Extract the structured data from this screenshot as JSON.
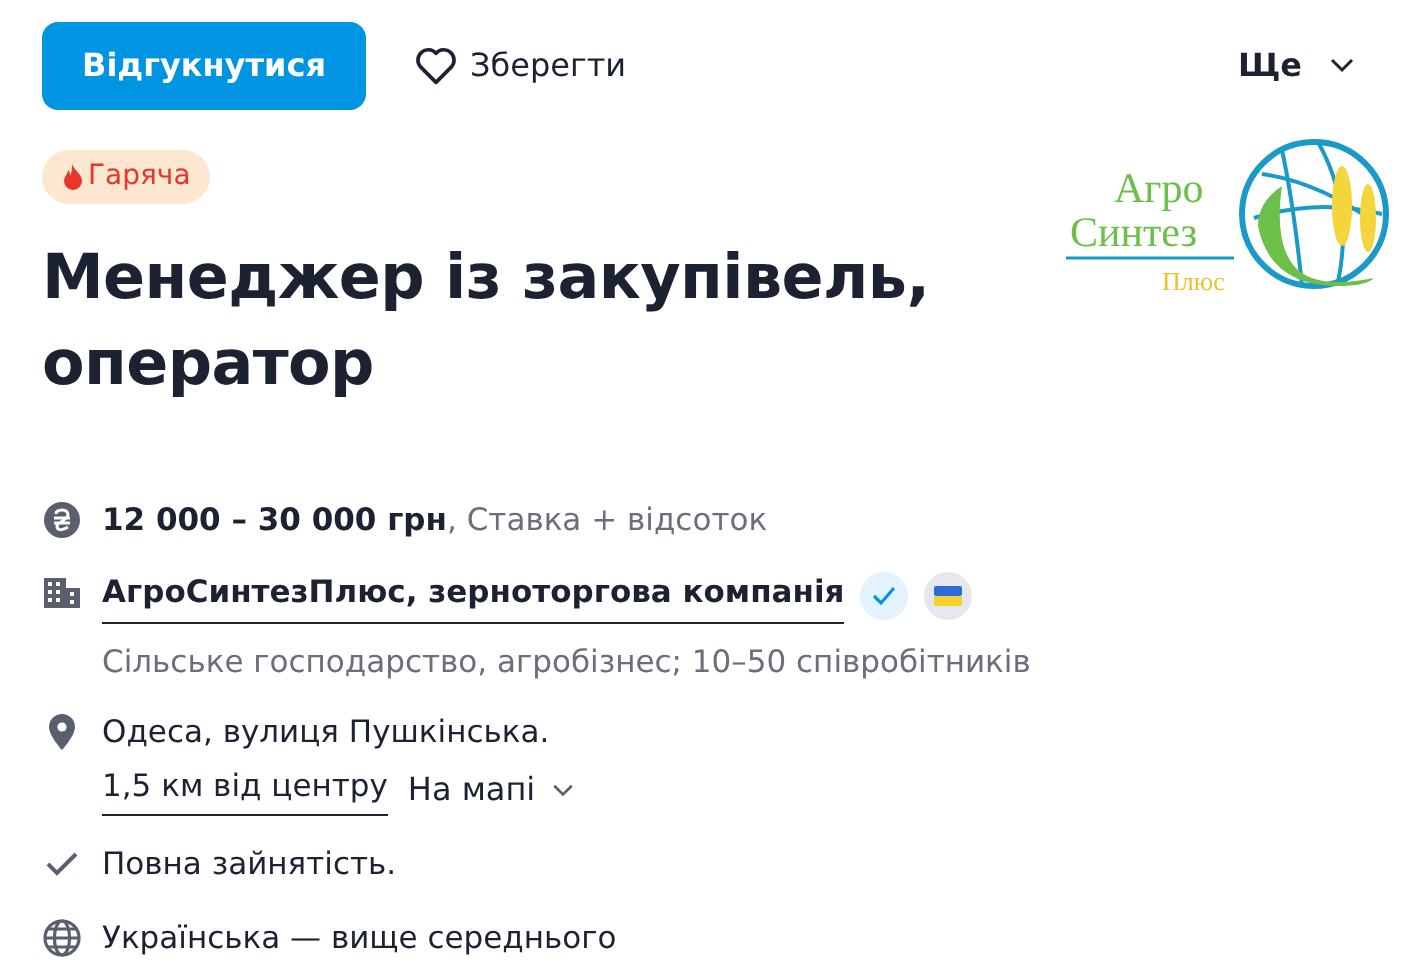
{
  "actions": {
    "apply": "Відгукнутися",
    "save": "Зберегти",
    "more": "Ще"
  },
  "tag": {
    "label": "Гаряча"
  },
  "title": "Менеджер із закупівель, оператор",
  "logo": {
    "lines": [
      "Агро",
      "Синтез",
      "Плюс"
    ]
  },
  "salary": {
    "amount": "12 000 – 30 000 грн",
    "note": ", Ставка + відсоток"
  },
  "company": {
    "name": "АгроСинтезПлюс, зерноторгова компанія",
    "verified": true,
    "details": "Сільське господарство, агробізнес; 10–50 співробітників"
  },
  "location": {
    "address": "Одеса, вулиця Пушкінська.",
    "distance": "1,5 км від центру",
    "map_link": "На мапі"
  },
  "employment": "Повна зайнятість.",
  "language": "Українська — вище середнього"
}
